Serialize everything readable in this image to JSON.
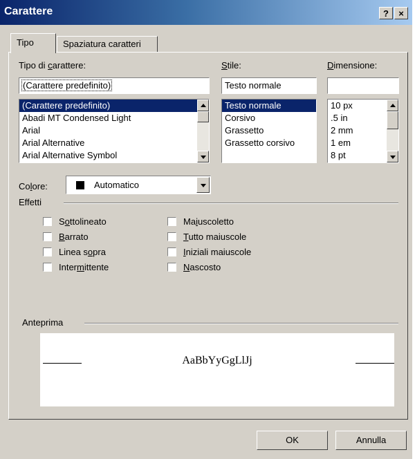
{
  "window": {
    "title": "Carattere",
    "help_label": "?",
    "close_label": "×"
  },
  "tabs": [
    {
      "label": "Tipo"
    },
    {
      "label": "Spaziatura caratteri"
    }
  ],
  "font": {
    "label_pre": "Tipo di ",
    "label_key": "c",
    "label_post": "arattere:",
    "value": "(Carattere predefinito)",
    "items": [
      "(Carattere predefinito)",
      "Abadi MT Condensed Light",
      "Arial",
      "Arial Alternative",
      "Arial Alternative Symbol"
    ]
  },
  "style": {
    "label_pre": "",
    "label_key": "S",
    "label_post": "tile:",
    "value": "Testo normale",
    "items": [
      "Testo normale",
      "Corsivo",
      "Grassetto",
      "Grassetto corsivo"
    ]
  },
  "size": {
    "label_pre": "",
    "label_key": "D",
    "label_post": "imensione:",
    "value": "",
    "items": [
      "10 px",
      ".5 in",
      "2 mm",
      "1 em",
      "8 pt"
    ]
  },
  "color": {
    "label_pre": "Co",
    "label_key": "l",
    "label_post": "ore:",
    "value": "Automatico",
    "swatch": "#000000"
  },
  "effects": {
    "title": "Effetti",
    "left": [
      {
        "pre": "S",
        "key": "o",
        "post": "ttolineato"
      },
      {
        "pre": "",
        "key": "B",
        "post": "arrato"
      },
      {
        "pre": "Linea s",
        "key": "o",
        "post": "pra"
      },
      {
        "pre": "Inter",
        "key": "m",
        "post": "ittente"
      }
    ],
    "right": [
      {
        "pre": "Ma",
        "key": "i",
        "post": "uscoletto"
      },
      {
        "pre": "",
        "key": "T",
        "post": "utto maiuscole"
      },
      {
        "pre": "",
        "key": "I",
        "post": "niziali maiuscole"
      },
      {
        "pre": "",
        "key": "N",
        "post": "ascosto"
      }
    ]
  },
  "preview": {
    "title": "Anteprima",
    "sample": "AaBbYyGgLlJj"
  },
  "buttons": {
    "ok": "OK",
    "cancel": "Annulla"
  },
  "colors": {
    "title_dark": "#0a246a",
    "title_light": "#a6caf0",
    "selection": "#0a246a",
    "face": "#d4d0c8"
  }
}
